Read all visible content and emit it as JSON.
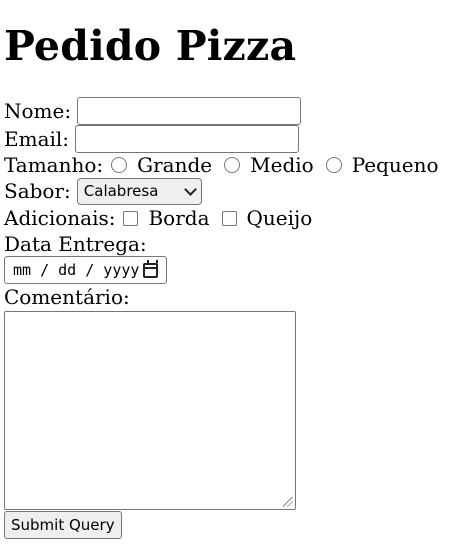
{
  "form": {
    "title": "Pedido Pizza",
    "name_label": "Nome:",
    "name_value": "",
    "email_label": "Email:",
    "email_value": "",
    "size_label": "Tamanho:",
    "size_options": [
      "Grande",
      "Medio",
      "Pequeno"
    ],
    "flavor_label": "Sabor:",
    "flavor_selected": "Calabresa",
    "extras_label": "Adicionais:",
    "extras_options": [
      "Borda",
      "Queijo"
    ],
    "delivery_label": "Data Entrega:",
    "delivery_placeholder": "mm / dd / yyyy",
    "comment_label": "Comentário:",
    "comment_value": "",
    "submit_label": "Submit Query"
  },
  "colors": {
    "text": "#000000",
    "control_border": "#767676",
    "button_bg": "#efefef"
  }
}
